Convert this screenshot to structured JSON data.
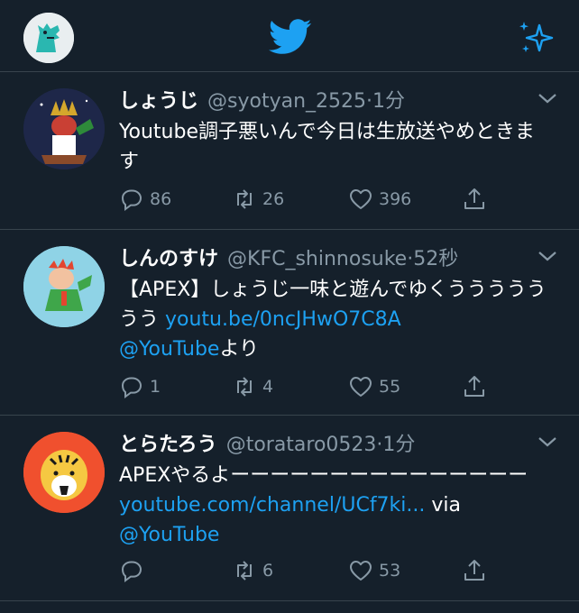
{
  "colors": {
    "background": "#15202b",
    "accent": "#1da1f2",
    "secondary_text": "#8899a6",
    "divider": "#38444d"
  },
  "header": {
    "avatar_icon": "user-avatar",
    "logo_icon": "twitter-bird-icon",
    "sparkle_icon": "sparkle-icon"
  },
  "tweets": [
    {
      "name": "しょうじ",
      "handle": "@syotyan_2525",
      "separator": "·",
      "time": "1分",
      "text_parts": [
        "Youtube調子悪いんで今日は生放送やめときます"
      ],
      "links": [],
      "replies": "86",
      "retweets": "26",
      "likes": "396"
    },
    {
      "name": "しんのすけ",
      "handle": "@KFC_shinnosuke",
      "separator": "·",
      "time": "52秒",
      "text_parts": [
        "【APEX】しょうじ一味と遊んでゆくううううううう ",
        "より"
      ],
      "links": [
        "youtu.be/0ncJHwO7C8A",
        "@YouTube"
      ],
      "replies": "1",
      "retweets": "4",
      "likes": "55"
    },
    {
      "name": "とらたろう",
      "handle": "@torataro0523",
      "separator": "·",
      "time": "1分",
      "text_parts": [
        "APEXやるよーーーーーーーーーーーーーーー",
        " via"
      ],
      "links": [
        "youtube.com/channel/UCf7ki...",
        "@YouTube"
      ],
      "replies": "",
      "retweets": "6",
      "likes": "53"
    }
  ]
}
